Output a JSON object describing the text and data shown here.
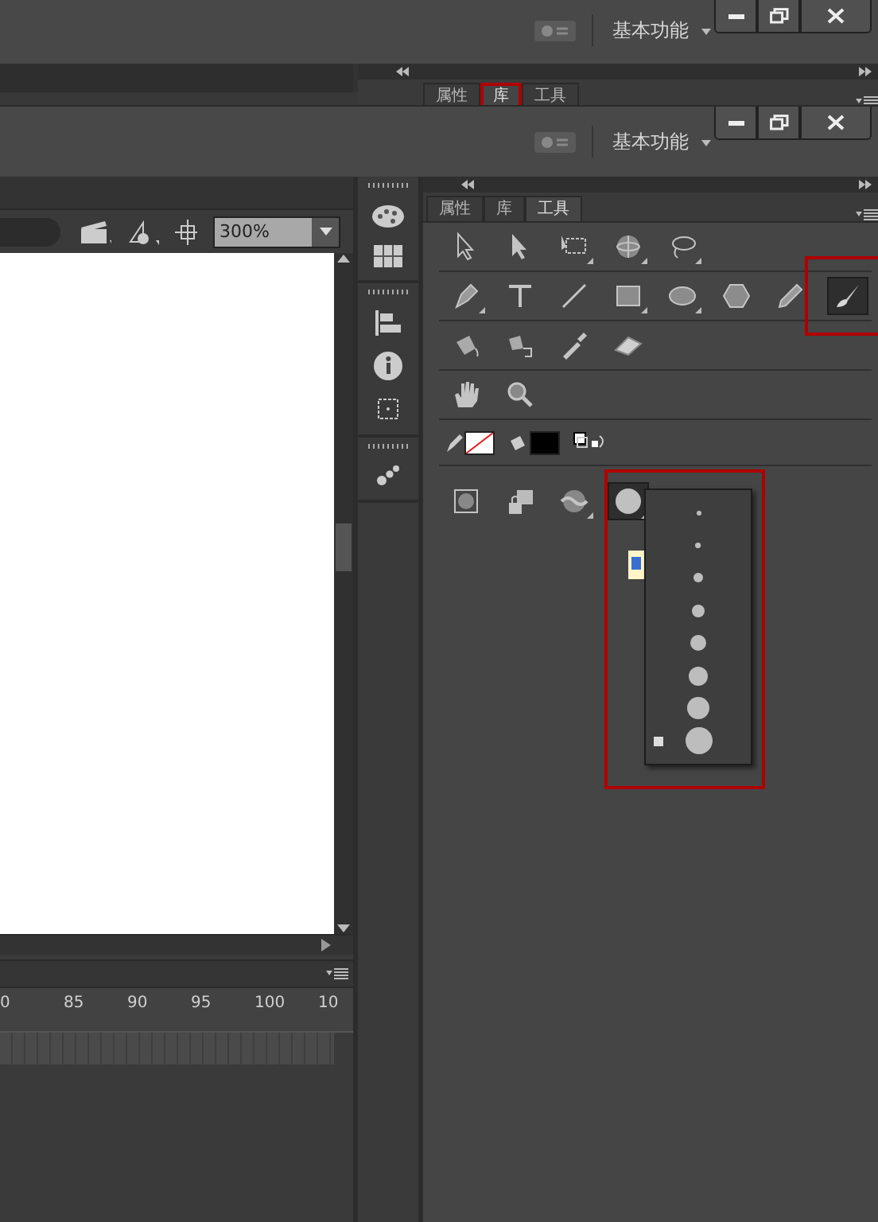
{
  "previous_screen": {
    "workspace": "基本功能",
    "tabs": [
      {
        "label": "属性",
        "selected": false,
        "highlighted": false
      },
      {
        "label": "库",
        "selected": true,
        "highlighted": true
      },
      {
        "label": "工具",
        "selected": false,
        "highlighted": false
      }
    ]
  },
  "title_bar": {
    "workspace": "基本功能"
  },
  "stage_toolbar": {
    "zoom": "300%"
  },
  "timeline": {
    "ruler": [
      "0",
      "85",
      "90",
      "95",
      "100",
      "10"
    ]
  },
  "tools_panel": {
    "tabs": [
      {
        "label": "属性",
        "selected": false
      },
      {
        "label": "库",
        "selected": false
      },
      {
        "label": "工具",
        "selected": true
      }
    ],
    "rows": [
      [
        {
          "kind": "select",
          "selected": false,
          "has_menu": false
        },
        {
          "kind": "subselect",
          "selected": false,
          "has_menu": false
        },
        {
          "kind": "transform",
          "selected": false,
          "has_menu": true
        },
        {
          "kind": "rotate3d",
          "selected": false,
          "has_menu": true
        },
        {
          "kind": "lasso",
          "selected": false,
          "has_menu": true
        }
      ],
      [
        {
          "kind": "pen",
          "selected": false,
          "has_menu": true
        },
        {
          "kind": "text",
          "selected": false,
          "has_menu": false
        },
        {
          "kind": "line",
          "selected": false,
          "has_menu": false
        },
        {
          "kind": "rect",
          "selected": false,
          "has_menu": true
        },
        {
          "kind": "oval",
          "selected": false,
          "has_menu": true
        },
        {
          "kind": "polystar",
          "selected": false,
          "has_menu": false
        },
        {
          "kind": "pencil",
          "selected": false,
          "has_menu": false
        },
        {
          "kind": "brush",
          "selected": true,
          "has_menu": false,
          "highlighted": true
        }
      ],
      [
        {
          "kind": "bucket",
          "selected": false,
          "has_menu": false
        },
        {
          "kind": "inkbottle",
          "selected": false,
          "has_menu": false
        },
        {
          "kind": "eyedropper",
          "selected": false,
          "has_menu": false
        },
        {
          "kind": "eraser",
          "selected": false,
          "has_menu": false
        }
      ],
      [
        {
          "kind": "hand",
          "selected": false,
          "has_menu": false
        },
        {
          "kind": "zoom",
          "selected": false,
          "has_menu": false
        }
      ]
    ],
    "options": [
      {
        "kind": "objectdraw",
        "selected": false,
        "has_menu": false
      },
      {
        "kind": "lockfill",
        "selected": false,
        "has_menu": false
      },
      {
        "kind": "brushmode",
        "selected": false,
        "has_menu": true
      },
      {
        "kind": "brushsize",
        "selected": true,
        "has_menu": true
      }
    ],
    "brush_sizes": {
      "highlighted": true,
      "items": [
        {
          "selected": false
        },
        {
          "selected": false
        },
        {
          "selected": false
        },
        {
          "selected": false
        },
        {
          "selected": false
        },
        {
          "selected": false
        },
        {
          "selected": false
        },
        {
          "selected": true
        }
      ]
    }
  }
}
